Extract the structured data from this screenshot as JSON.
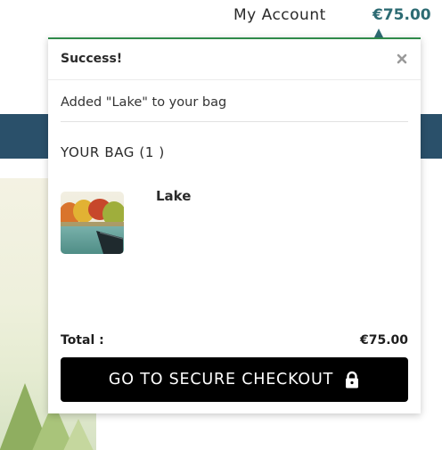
{
  "header": {
    "account_label": "My Account",
    "cart_total": "€75.00"
  },
  "popup": {
    "status_title": "Success!",
    "close_icon": "close-icon",
    "added_message": "Added \"Lake\" to your bag",
    "bag_heading": "YOUR BAG (1 )",
    "items": [
      {
        "name": "Lake",
        "thumbnail": "lake-painting-thumbnail"
      }
    ],
    "total_label": "Total :",
    "total_value": "€75.00",
    "checkout_label": "GO TO SECURE CHECKOUT",
    "checkout_icon": "lock-icon"
  },
  "colors": {
    "price_accent": "#2d6b73",
    "popup_border": "#2f8a4a",
    "nav_band": "#2a506a",
    "checkout_bg": "#000000"
  }
}
